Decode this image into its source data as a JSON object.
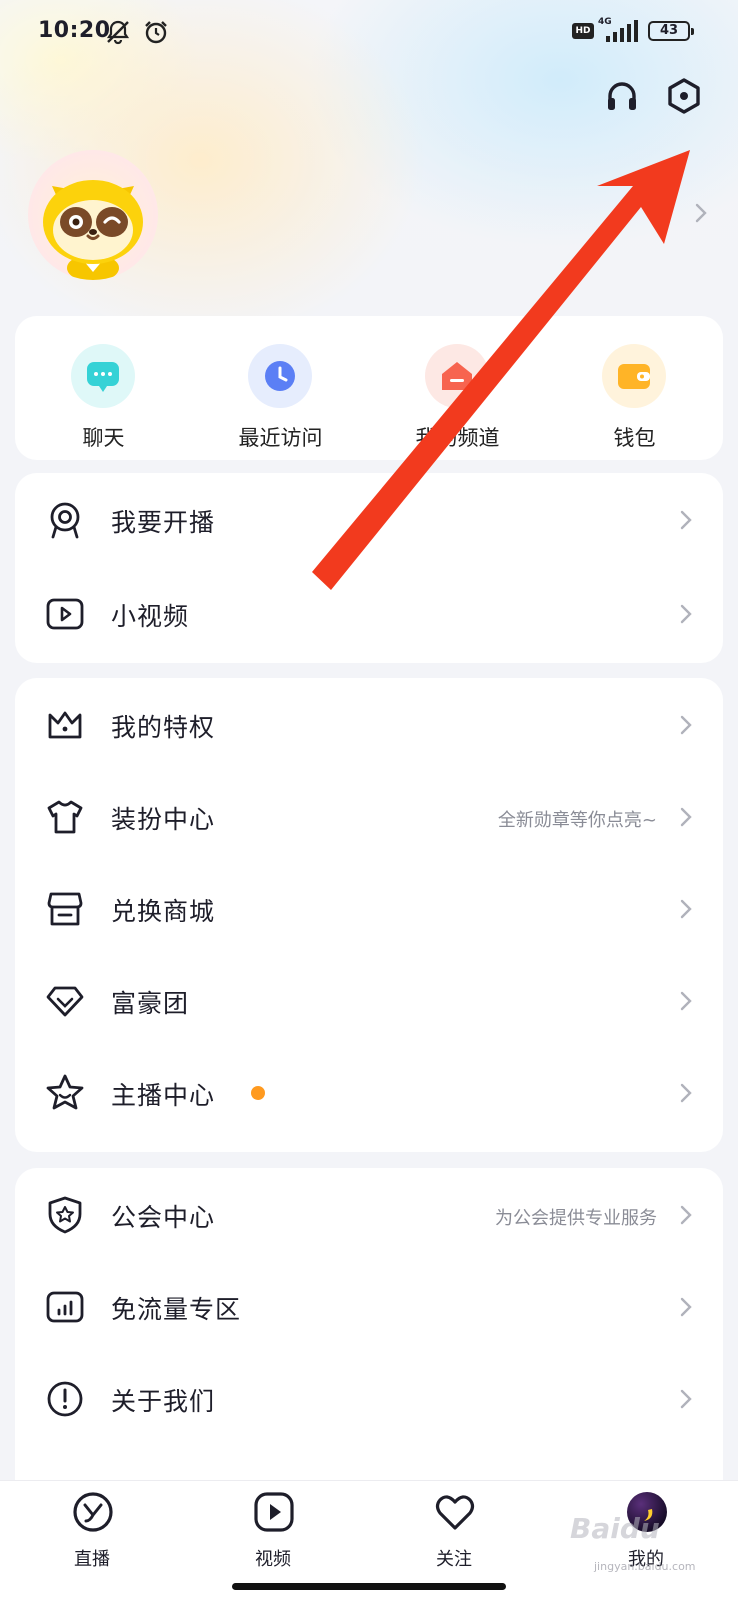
{
  "status_bar": {
    "time": "10:20",
    "hd_label": "HD",
    "network": "4G",
    "battery": "43"
  },
  "profile": {
    "avatar_alt": "raccoon mascot avatar"
  },
  "quick_actions": [
    {
      "label": "聊天",
      "icon": "chat-icon",
      "color": "#35d2d6",
      "bg": "#dff8f8"
    },
    {
      "label": "最近访问",
      "icon": "clock-icon",
      "color": "#5b7ff5",
      "bg": "#e6edfd"
    },
    {
      "label": "我的频道",
      "icon": "channel-house-icon",
      "color": "#f7644f",
      "bg": "#fde8e4"
    },
    {
      "label": "钱包",
      "icon": "wallet-icon",
      "color": "#ffb427",
      "bg": "#fff3dc"
    }
  ],
  "menu_group_1": [
    {
      "label": "我要开播",
      "icon": "camera-broadcast-icon"
    },
    {
      "label": "小视频",
      "icon": "video-play-icon"
    }
  ],
  "menu_group_2": [
    {
      "label": "我的特权",
      "icon": "crown-icon"
    },
    {
      "label": "装扮中心",
      "icon": "tshirt-icon",
      "hint": "全新勋章等你点亮~"
    },
    {
      "label": "兑换商城",
      "icon": "store-icon"
    },
    {
      "label": "富豪团",
      "icon": "diamond-icon"
    },
    {
      "label": "主播中心",
      "icon": "star-icon",
      "badge": true
    }
  ],
  "menu_group_3": [
    {
      "label": "公会中心",
      "icon": "shield-star-icon",
      "hint": "为公会提供专业服务"
    },
    {
      "label": "免流量专区",
      "icon": "data-chart-icon"
    },
    {
      "label": "关于我们",
      "icon": "info-exclaim-icon"
    }
  ],
  "tab_bar": [
    {
      "label": "直播",
      "icon": "live-logo-icon"
    },
    {
      "label": "视频",
      "icon": "video-play-icon"
    },
    {
      "label": "关注",
      "icon": "heart-icon"
    },
    {
      "label": "我的",
      "icon": "avatar-moon-icon",
      "active": true
    }
  ],
  "watermark": {
    "text": "Baidu",
    "url": "jingyan.baidu.com"
  },
  "annotation_color": "#f23a1e"
}
